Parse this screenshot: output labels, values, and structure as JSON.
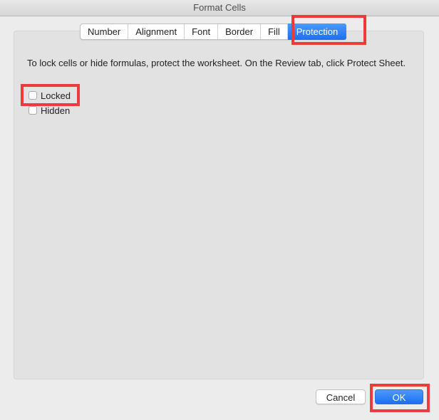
{
  "window": {
    "title": "Format Cells"
  },
  "tabs": [
    {
      "label": "Number",
      "active": false
    },
    {
      "label": "Alignment",
      "active": false
    },
    {
      "label": "Font",
      "active": false
    },
    {
      "label": "Border",
      "active": false
    },
    {
      "label": "Fill",
      "active": false
    },
    {
      "label": "Protection",
      "active": true
    }
  ],
  "protection": {
    "description": "To lock cells or hide formulas, protect the worksheet. On the Review tab, click Protect Sheet.",
    "options": [
      {
        "label": "Locked",
        "checked": false
      },
      {
        "label": "Hidden",
        "checked": false
      }
    ]
  },
  "buttons": {
    "cancel": "Cancel",
    "ok": "OK"
  },
  "colors": {
    "accent": "#1e6ef3",
    "highlight": "#ee3a3a"
  }
}
